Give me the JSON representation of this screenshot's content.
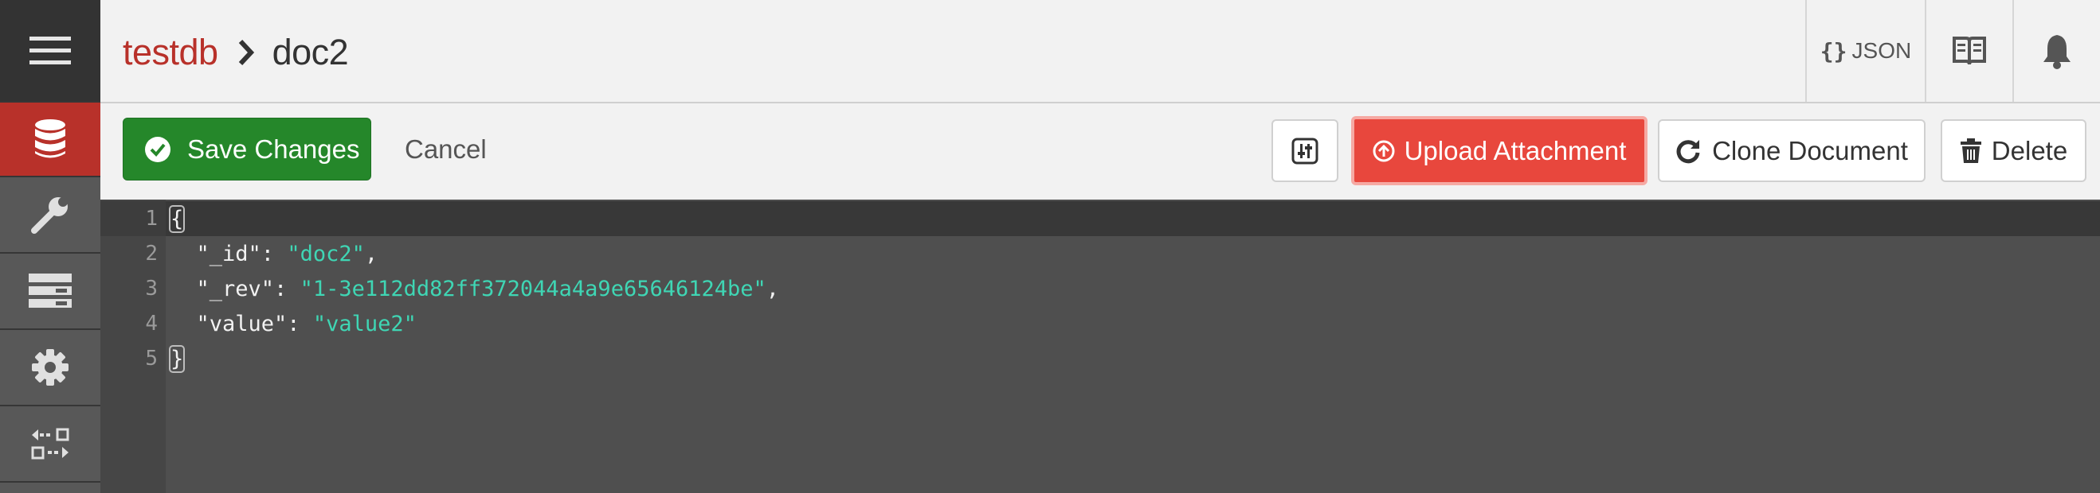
{
  "sidebar": {
    "items": [
      {
        "name": "menu",
        "icon": "hamburger-menu-icon"
      },
      {
        "name": "databases",
        "icon": "database-icon",
        "active": true
      },
      {
        "name": "setup",
        "icon": "wrench-icon"
      },
      {
        "name": "active-tasks",
        "icon": "server-stack-icon"
      },
      {
        "name": "config",
        "icon": "gear-icon"
      },
      {
        "name": "replication",
        "icon": "replication-arrows-icon"
      }
    ],
    "active_color": "#b8312a"
  },
  "header": {
    "breadcrumb": {
      "database": "testdb",
      "document": "doc2"
    },
    "json_button": {
      "icon": "braces-icon",
      "label": "JSON"
    },
    "docs_button": {
      "icon": "book-icon"
    },
    "notifications_button": {
      "icon": "bell-icon"
    }
  },
  "toolbar": {
    "save_label": "Save Changes",
    "cancel_label": "Cancel",
    "upload_label": "Upload Attachment",
    "clone_label": "Clone Document",
    "delete_label": "Delete",
    "colors": {
      "save": "#25872a",
      "upload": "#e8473d"
    }
  },
  "editor": {
    "lines": [
      {
        "number": "1",
        "parts": [
          {
            "t": "{",
            "hl": true
          }
        ]
      },
      {
        "number": "2",
        "parts": [
          {
            "t": "  \"_id\": "
          },
          {
            "t": "\"doc2\"",
            "s": true
          },
          {
            "t": ","
          }
        ]
      },
      {
        "number": "3",
        "parts": [
          {
            "t": "  \"_rev\": "
          },
          {
            "t": "\"1-3e112dd82ff372044a4a9e65646124be\"",
            "s": true
          },
          {
            "t": ","
          }
        ]
      },
      {
        "number": "4",
        "parts": [
          {
            "t": "  \"value\": "
          },
          {
            "t": "\"value2\"",
            "s": true
          }
        ]
      },
      {
        "number": "5",
        "parts": [
          {
            "t": "}",
            "hl": true
          }
        ]
      }
    ],
    "string_color": "#3fd6b4"
  }
}
